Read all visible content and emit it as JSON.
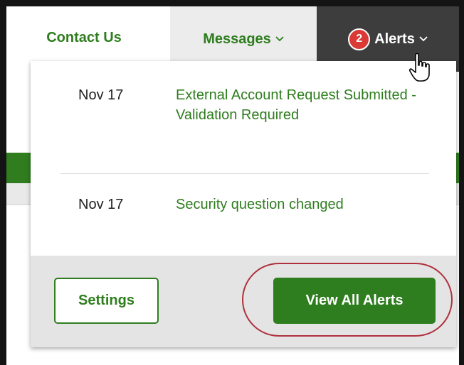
{
  "nav": {
    "contact": "Contact Us",
    "messages": "Messages",
    "alerts": "Alerts",
    "alert_count": "2"
  },
  "alerts_menu": {
    "items": [
      {
        "date": "Nov 17",
        "title": "External Account Request Submitted - Validation Required"
      },
      {
        "date": "Nov 17",
        "title": "Security question changed"
      }
    ],
    "settings_label": "Settings",
    "view_all_label": "View All Alerts"
  },
  "colors": {
    "brand_green": "#2e7d1e",
    "badge_red": "#d93a36",
    "active_tab": "#3d3d3d",
    "annotation": "#b0303e"
  },
  "icons": [
    "chevron-down-icon",
    "hand-cursor-icon"
  ]
}
